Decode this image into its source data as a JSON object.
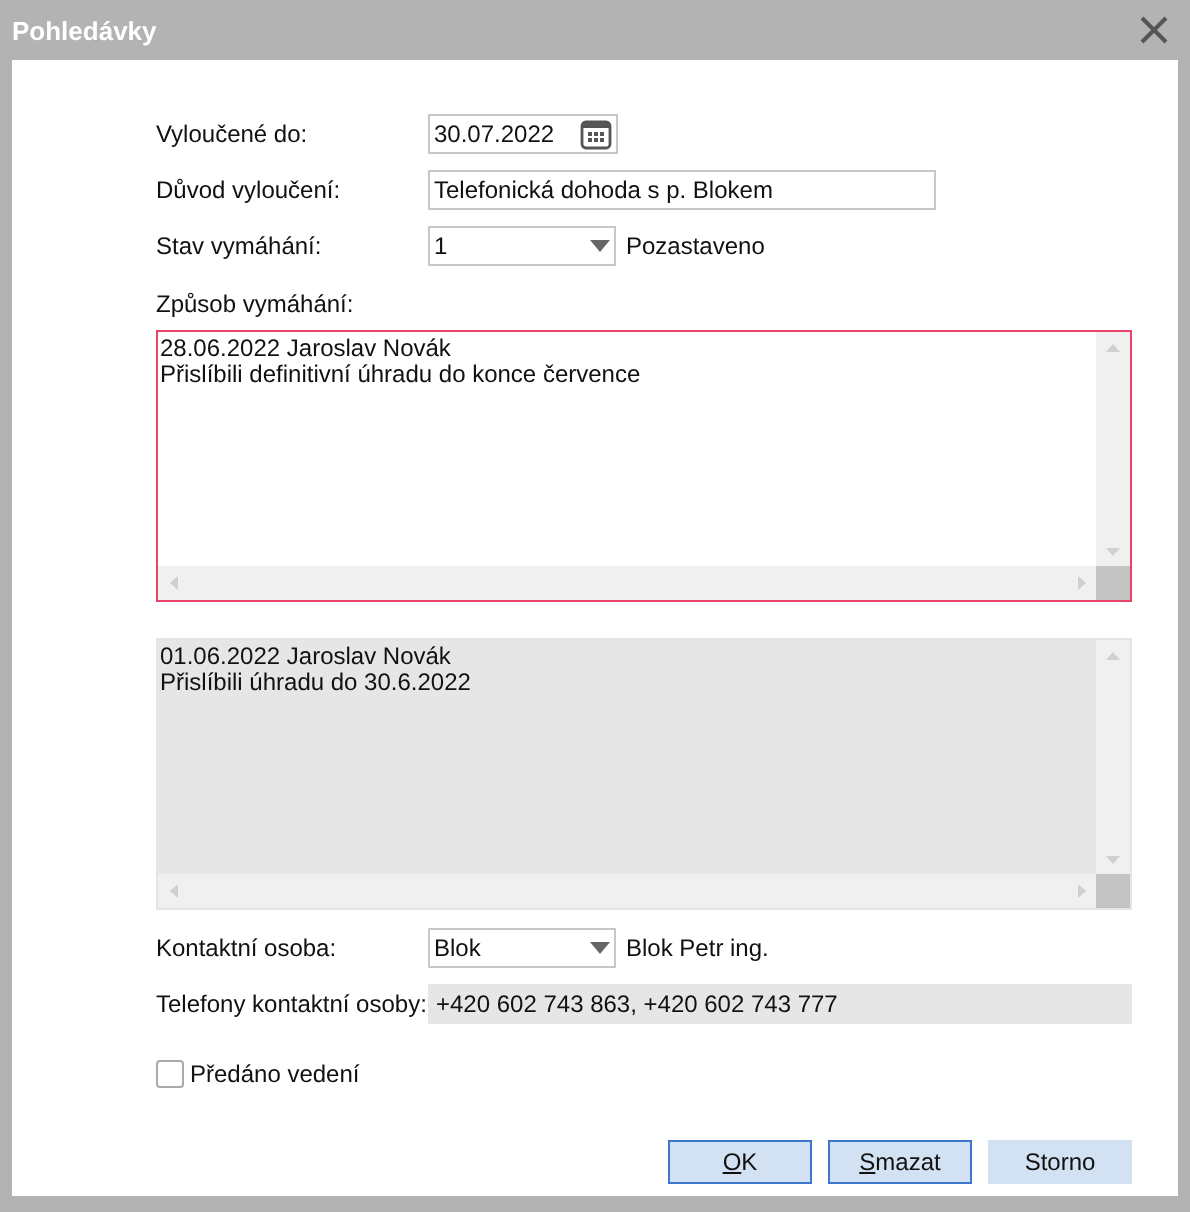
{
  "window": {
    "title": "Pohledávky"
  },
  "excluded_until": {
    "label": "Vyloučené do:",
    "value": "30.07.2022"
  },
  "exclusion_reason": {
    "label": "Důvod vyloučení:",
    "value": "Telefonická dohoda s p. Blokem"
  },
  "enforcement_state": {
    "label": "Stav vymáhání:",
    "value": "1",
    "description": "Pozastaveno"
  },
  "enforcement_method": {
    "label": "Způsob vymáhání:",
    "lines": [
      "28.06.2022 Jaroslav Novák",
      "Přislíbili definitivní úhradu do konce července"
    ],
    "focused": true,
    "disabled": false
  },
  "history": {
    "lines": [
      "01.06.2022 Jaroslav Novák",
      "Přislíbili úhradu do 30.6.2022"
    ],
    "focused": false,
    "disabled": true
  },
  "contact_person": {
    "label": "Kontaktní osoba:",
    "value": "Blok",
    "description": "Blok Petr ing."
  },
  "contact_phones": {
    "label": "Telefony kontaktní osoby:",
    "value": "+420 602 743 863, +420 602 743 777"
  },
  "handed_to_management": {
    "label": "Předáno vedení",
    "checked": false
  },
  "buttons": [
    {
      "label": "OK",
      "mnemonic": true,
      "outlined": true
    },
    {
      "label": "Smazat",
      "mnemonic": true,
      "outlined": true
    },
    {
      "label": "Storno",
      "mnemonic": false,
      "outlined": false
    }
  ]
}
